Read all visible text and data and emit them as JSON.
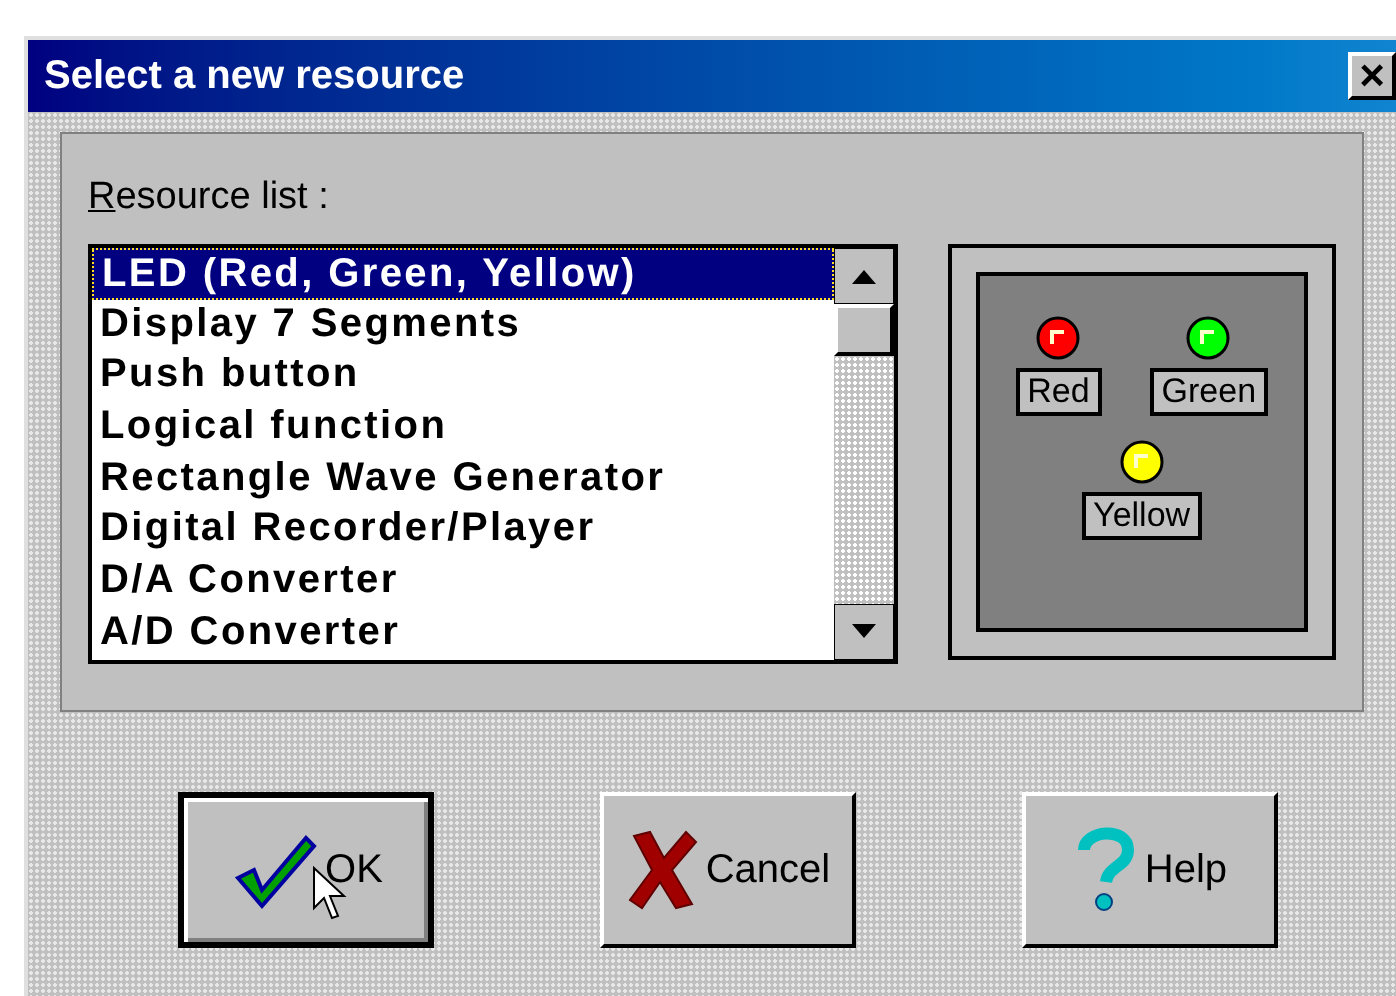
{
  "window": {
    "title": "Select a new resource",
    "close": "×"
  },
  "resource_list": {
    "label": "Resource list :",
    "items": [
      {
        "label": "LED (Red, Green, Yellow)",
        "selected": true
      },
      {
        "label": "Display 7 Segments",
        "selected": false
      },
      {
        "label": "Push button",
        "selected": false
      },
      {
        "label": "Logical function",
        "selected": false
      },
      {
        "label": "Rectangle Wave Generator",
        "selected": false
      },
      {
        "label": "Digital Recorder/Player",
        "selected": false
      },
      {
        "label": "D/A Converter",
        "selected": false
      },
      {
        "label": "A/D Converter",
        "selected": false
      }
    ]
  },
  "preview": {
    "leds": [
      {
        "label": "Red",
        "color": "#ff0000"
      },
      {
        "label": "Green",
        "color": "#00ff00"
      },
      {
        "label": "Yellow",
        "color": "#ffff00"
      }
    ]
  },
  "buttons": [
    {
      "kind": "ok",
      "label": "OK",
      "default": true
    },
    {
      "kind": "cancel",
      "label": "Cancel",
      "default": false
    },
    {
      "kind": "help",
      "label": "Help",
      "default": false
    }
  ]
}
